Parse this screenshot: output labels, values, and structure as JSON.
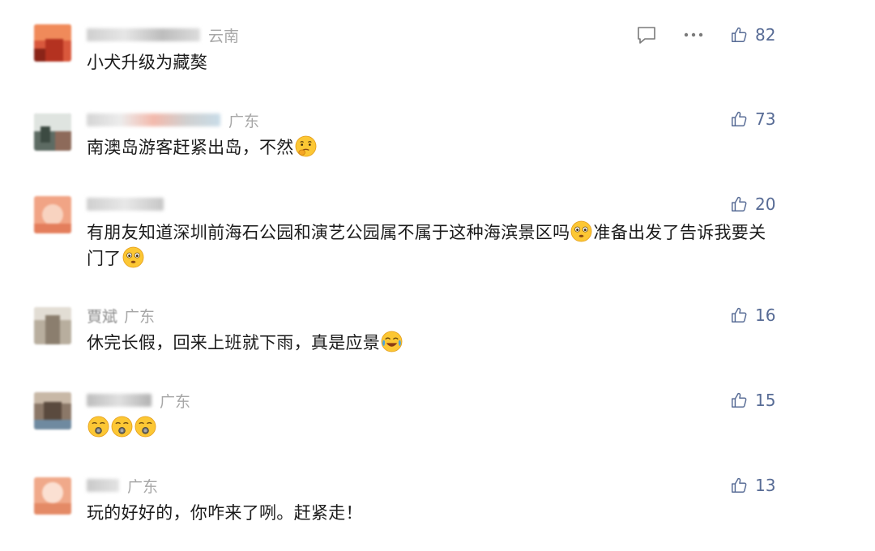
{
  "comments": [
    {
      "region": "云南",
      "text": "小犬升级为藏獒",
      "likes": "82",
      "avatar_color": "#d9583c"
    },
    {
      "region": "广东",
      "text": "南澳岛游客赶紧出岛，不然",
      "likes": "73",
      "avatar_color": "#5d6b63"
    },
    {
      "region": "",
      "text": "有朋友知道深圳前海石公园和演艺公园属不属于这种海滨景区吗",
      "text2": "准备出发了告诉我要关门了",
      "likes": "20",
      "avatar_color": "#f1a485"
    },
    {
      "region": "广东",
      "name_partial": "賈斌",
      "text": "休完长假，回来上班就下雨，真是应景",
      "likes": "16",
      "avatar_color": "#b8ae9e"
    },
    {
      "region": "广东",
      "text": "",
      "likes": "15",
      "avatar_color": "#8b7868"
    },
    {
      "region": "广东",
      "text": "玩的好好的，你咋来了咧。赶紧走！",
      "likes": "13",
      "avatar_color": "#f0a98a"
    }
  ],
  "icons": {
    "reply": "speech-bubble-icon",
    "more": "ellipsis-icon",
    "like": "thumbs-up-icon"
  },
  "colors": {
    "link_blue": "#576b95",
    "region_gray": "#a7a7a7",
    "text": "#1b1b1b"
  }
}
